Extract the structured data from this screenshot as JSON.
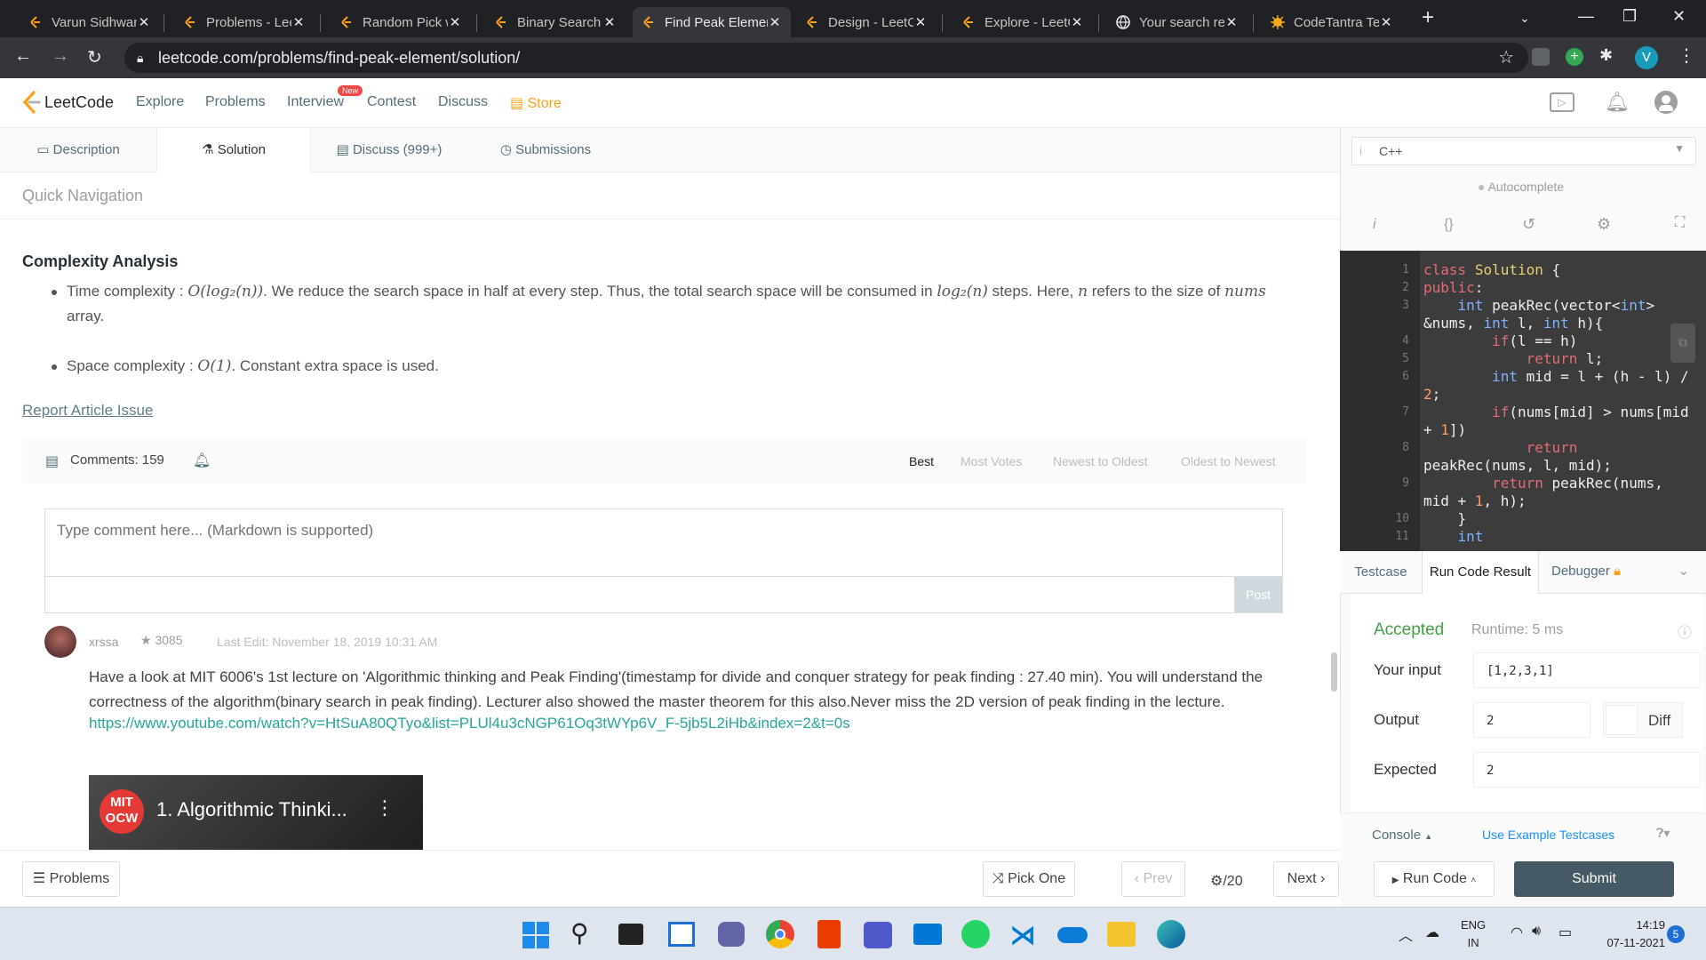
{
  "browser": {
    "tabs": [
      {
        "title": "Varun Sidhwani",
        "active": false
      },
      {
        "title": "Problems - LeetCode",
        "active": false
      },
      {
        "title": "Random Pick with",
        "active": false
      },
      {
        "title": "Binary Search",
        "active": false
      },
      {
        "title": "Find Peak Element",
        "active": true
      },
      {
        "title": "Design - LeetCode",
        "active": false
      },
      {
        "title": "Explore - LeetCode",
        "active": false
      },
      {
        "title": "Your search results",
        "active": false
      },
      {
        "title": "CodeTantra Tech",
        "active": false
      }
    ],
    "url": "leetcode.com/problems/find-peak-element/solution/",
    "profile_initial": "V"
  },
  "nav": {
    "logo": "LeetCode",
    "items": [
      "Explore",
      "Problems",
      "Interview",
      "Contest",
      "Discuss"
    ],
    "new_badge": "New",
    "store": "Store"
  },
  "tabs": {
    "description": "Description",
    "solution": "Solution",
    "discuss": "Discuss (999+)",
    "submissions": "Submissions"
  },
  "content": {
    "quick_nav": "Quick Navigation",
    "heading": "Complexity Analysis",
    "time_label": "Time complexity :",
    "time_big_o": "O(log₂(n))",
    "time_text_a": ". We reduce the search space in half at every step. Thus, the total search space will be consumed in",
    "time_log": "log₂(n)",
    "time_text_b": "steps. Here,",
    "time_n": "n",
    "time_text_c": "refers to the size of",
    "time_nums": "nums",
    "time_text_d": "array.",
    "space_label": "Space complexity :",
    "space_big_o": "O(1)",
    "space_text": ". Constant extra space is used.",
    "report": "Report Article Issue",
    "comments": "Comments: 159",
    "sort": [
      "Best",
      "Most Votes",
      "Newest to Oldest",
      "Oldest to Newest"
    ],
    "comment_placeholder": "Type comment here... (Markdown is supported)",
    "post": "Post",
    "comment": {
      "user": "xrssa",
      "stars": "3085",
      "edited": "Last Edit: November 18, 2019 10:31 AM",
      "body": "Have a look at MIT 6006's 1st lecture on 'Algorithmic thinking and Peak Finding'(timestamp for divide and conquer strategy for peak finding : 27.40 min). You will understand the correctness of the algorithm(binary search in peak finding). Lecturer also showed the master theorem for this also.Never miss the 2D version of peak finding in the lecture.",
      "link": "https://www.youtube.com/watch?v=HtSuA80QTyo&list=PLUl4u3cNGP61Oq3tWYp6V_F-5jb5L2iHb&index=2&t=0s",
      "video_title": "1. Algorithmic Thinki...",
      "video_logo_top": "MIT",
      "video_logo_bottom": "OCW"
    }
  },
  "editor": {
    "language": "C++",
    "autocomplete": "Autocomplete",
    "line_numbers": [
      "1",
      "2",
      "3",
      "",
      "4",
      "5",
      "6",
      "",
      "7",
      "",
      "8",
      "",
      "9",
      "",
      "10",
      "11"
    ]
  },
  "result": {
    "tabs": [
      "Testcase",
      "Run Code Result",
      "Debugger"
    ],
    "status": "Accepted",
    "runtime": "Runtime: 5 ms",
    "input_label": "Your input",
    "input": "[1,2,3,1]",
    "output_label": "Output",
    "output": "2",
    "diff": "Diff",
    "expected_label": "Expected",
    "expected": "2",
    "console": "Console",
    "use_example": "Use Example Testcases",
    "run_code": "Run Code",
    "submit": "Submit"
  },
  "footer": {
    "problems": "Problems",
    "pick_one": "Pick One",
    "prev": "Prev",
    "page": "/20",
    "next": "Next"
  },
  "taskbar": {
    "lang_top": "ENG",
    "lang_bottom": "IN",
    "time": "14:19",
    "date": "07-11-2021",
    "notifications": "5"
  },
  "colors": {
    "accent_orange": "#ffa116",
    "accepted_green": "#43a047",
    "link_blue": "#1a90ff",
    "submit_bg": "#455a64"
  }
}
